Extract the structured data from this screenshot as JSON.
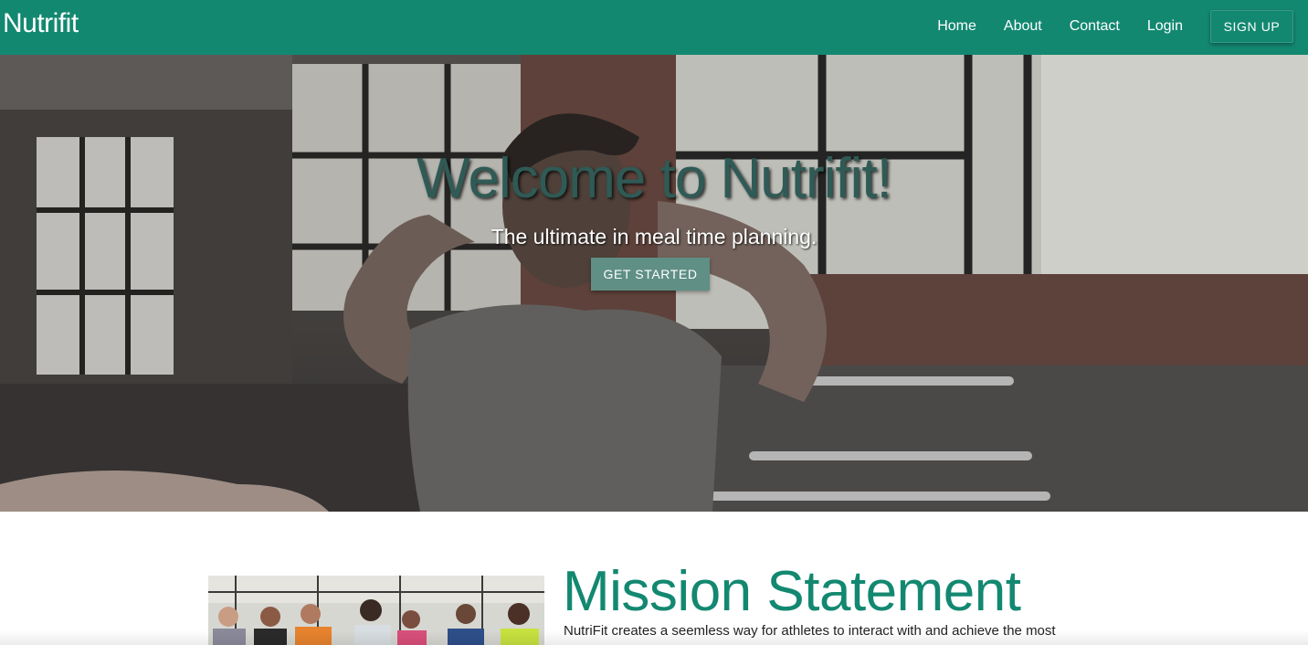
{
  "nav": {
    "brand": "Nutrifit",
    "links": [
      {
        "label": "Home"
      },
      {
        "label": "About"
      },
      {
        "label": "Contact"
      },
      {
        "label": "Login"
      }
    ],
    "signup_label": "SIGN UP"
  },
  "hero": {
    "title": "Welcome to Nutrifit!",
    "subtitle": "The ultimate in meal time planning.",
    "cta_label": "GET STARTED",
    "image": "athlete-gym-photo"
  },
  "mission": {
    "heading": "Mission Statement",
    "text": "NutriFit creates a seemless way for athletes to interact with and achieve the most",
    "image": "group-of-athletes-photo"
  },
  "colors": {
    "brand": "#138871",
    "cta": "#5f8f85",
    "hero_title": "#2f5a55"
  }
}
